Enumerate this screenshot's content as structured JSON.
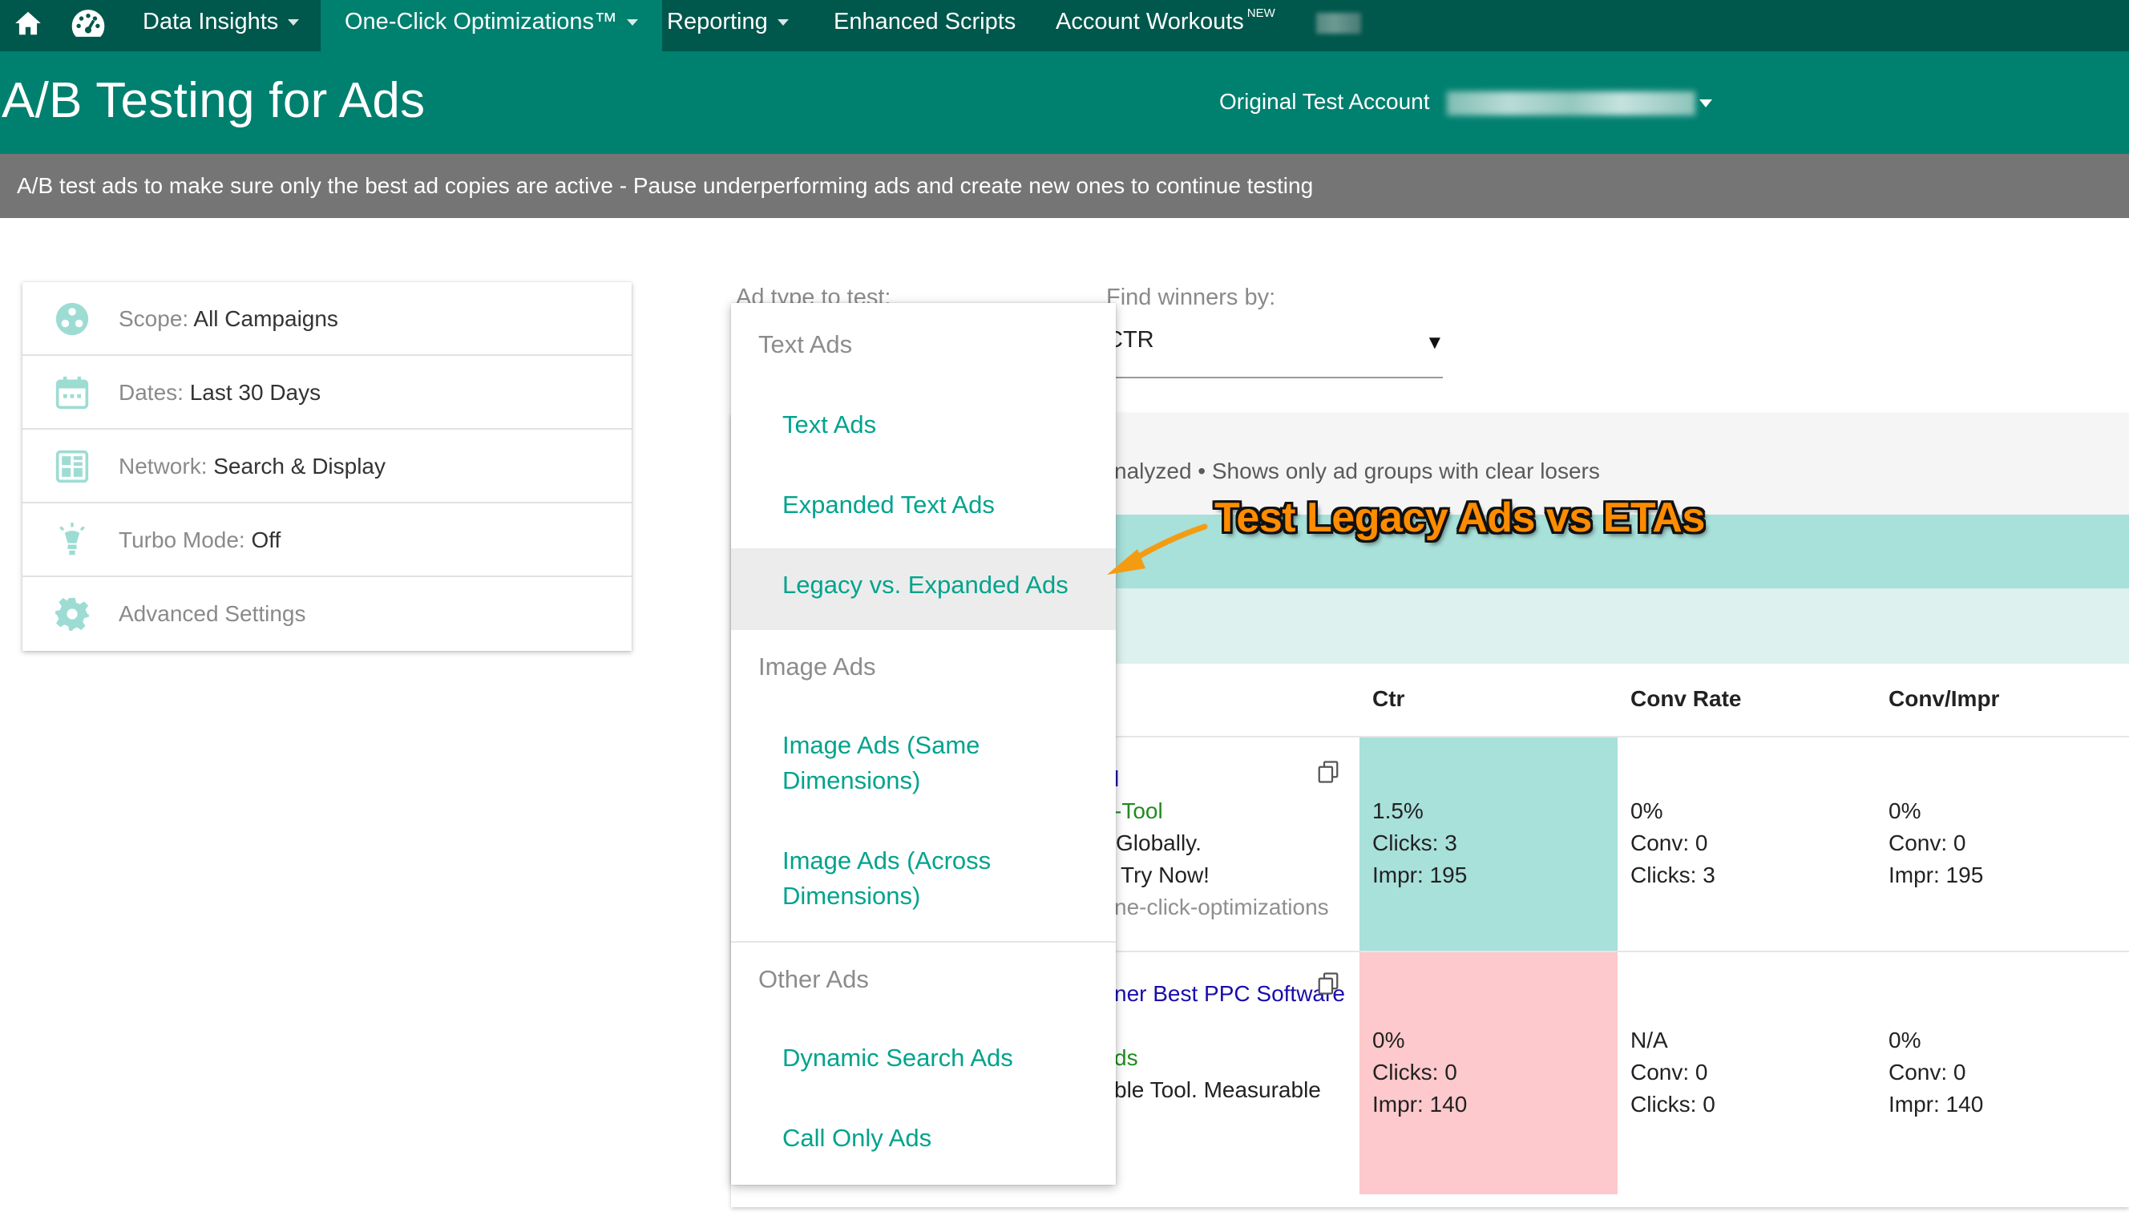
{
  "nav": {
    "items": [
      {
        "label": "Data Insights"
      },
      {
        "label": "One-Click Optimizations™"
      },
      {
        "label": "Reporting"
      },
      {
        "label": "Enhanced Scripts"
      },
      {
        "label": "Account Workouts"
      }
    ],
    "new_badge": "NEW"
  },
  "header": {
    "title": "A/B Testing for Ads",
    "account_label": "Original Test Account"
  },
  "subheader": {
    "text": "A/B test ads to make sure only the best ad copies are active - Pause underperforming ads and create new ones to continue testing"
  },
  "settings": [
    {
      "key": "Scope: ",
      "value": "All Campaigns",
      "icon": "scope-icon"
    },
    {
      "key": "Dates: ",
      "value": "Last 30 Days",
      "icon": "calendar-icon"
    },
    {
      "key": "Network: ",
      "value": "Search & Display",
      "icon": "network-icon"
    },
    {
      "key": "Turbo Mode: ",
      "value": "Off",
      "icon": "lightbulb-icon"
    },
    {
      "key": "Advanced Settings",
      "value": "",
      "icon": "gear-icon"
    }
  ],
  "form": {
    "adtype_label": "Ad type to test:",
    "findby_label": "Find winners by:",
    "findby_value": "CTR"
  },
  "dropdown": {
    "groups": [
      {
        "header": "Text Ads",
        "items": [
          "Text Ads",
          "Expanded Text Ads",
          "Legacy vs. Expanded Ads"
        ]
      },
      {
        "header": "Image Ads",
        "items": [
          "Image Ads (Same Dimensions)",
          "Image Ads (Across Dimensions)"
        ]
      },
      {
        "header": "Other Ads",
        "items": [
          "Dynamic Search Ads",
          "Call Only Ads"
        ]
      }
    ],
    "highlighted": "Legacy vs. Expanded Ads"
  },
  "results": {
    "info": "nalyzed • Shows only ad groups with clear losers",
    "columns": [
      "Ctr",
      "Conv Rate",
      "Conv/Impr"
    ],
    "rows": [
      {
        "ad_lines": [
          "l",
          "-Tool",
          "Globally.",
          "Try Now!",
          "ne-click-optimizations"
        ],
        "ctr": [
          "1.5%",
          "Clicks: 3",
          "Impr: 195"
        ],
        "conv_rate": [
          "0%",
          "Conv: 0",
          "Clicks: 3"
        ],
        "conv_impr": [
          "0%",
          "Conv: 0",
          "Impr: 195"
        ],
        "status_color": "#a8e0da"
      },
      {
        "ad_lines": [
          "ner Best PPC Software",
          "ds",
          "ble Tool. Measurable"
        ],
        "ctr": [
          "0%",
          "Clicks: 0",
          "Impr: 140"
        ],
        "conv_rate": [
          "N/A",
          "Conv: 0",
          "Clicks: 0"
        ],
        "conv_impr": [
          "0%",
          "Conv: 0",
          "Impr: 140"
        ],
        "status_color": "#fdc9cc"
      }
    ]
  },
  "annotation": {
    "text": "Test Legacy Ads vs ETAs",
    "color": "#ff8c00"
  },
  "colors": {
    "nav_bg": "#00574c",
    "header_bg": "#00806f",
    "accent": "#00a38d",
    "subheader_bg": "#757575"
  }
}
